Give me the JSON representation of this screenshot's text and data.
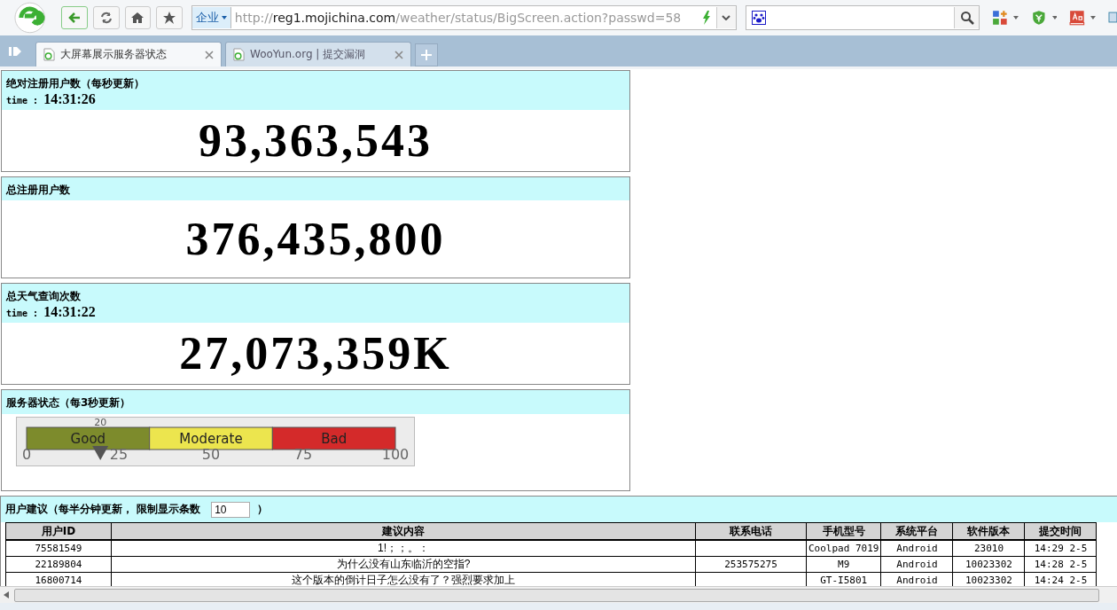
{
  "browser": {
    "scope": "企业",
    "address": {
      "scheme": "http://",
      "host": "reg1.mojichina.com",
      "path": "/weather/status/BigScreen.action?passwd=58"
    },
    "tabs": [
      {
        "title": "大屏幕展示服务器状态",
        "selected": true
      },
      {
        "title": "WooYun.org | 提交漏洞",
        "selected": false
      }
    ]
  },
  "panels": [
    {
      "kind": "counter",
      "title": "绝对注册用户数（每秒更新）",
      "time_label": "time :",
      "time": "14:31:26",
      "value": "93,363,543"
    },
    {
      "kind": "counter",
      "title": "总注册用户数",
      "value": "376,435,800"
    },
    {
      "kind": "counter",
      "title": "总天气查询次数",
      "time_label": "time :",
      "time": "14:31:22",
      "value": "27,073,359K"
    },
    {
      "kind": "gauge",
      "title": "服务器状态（每3秒更新）",
      "gauge": {
        "level": 0.2,
        "reading": "20",
        "scale": [
          "0",
          "25",
          "50",
          "75",
          "100"
        ],
        "bands": [
          {
            "label": "Good",
            "color": "#7d8b2c"
          },
          {
            "label": "Moderate",
            "color": "#ece54e"
          },
          {
            "label": "Bad",
            "color": "#d42a2a"
          }
        ]
      }
    }
  ],
  "suggestions": {
    "title": "用户建议（每半分钟更新， 限制显示条数",
    "limit": "10",
    "title_end": "）",
    "columns": [
      "用户ID",
      "建议内容",
      "联系电话",
      "手机型号",
      "系统平台",
      "软件版本",
      "提交时间"
    ],
    "rows": [
      [
        "75581549",
        "1!；；。：",
        "",
        "Coolpad 7019",
        "Android",
        "23010",
        "14:29 2-5"
      ],
      [
        "22189804",
        "为什么没有山东临沂的空指?",
        "253575275",
        "M9",
        "Android",
        "10023302",
        "14:28 2-5"
      ],
      [
        "16800714",
        "这个版本的倒计日子怎么没有了？强烈要求加上",
        "",
        "GT-I5801",
        "Android",
        "10023302",
        "14:24 2-5"
      ]
    ]
  }
}
